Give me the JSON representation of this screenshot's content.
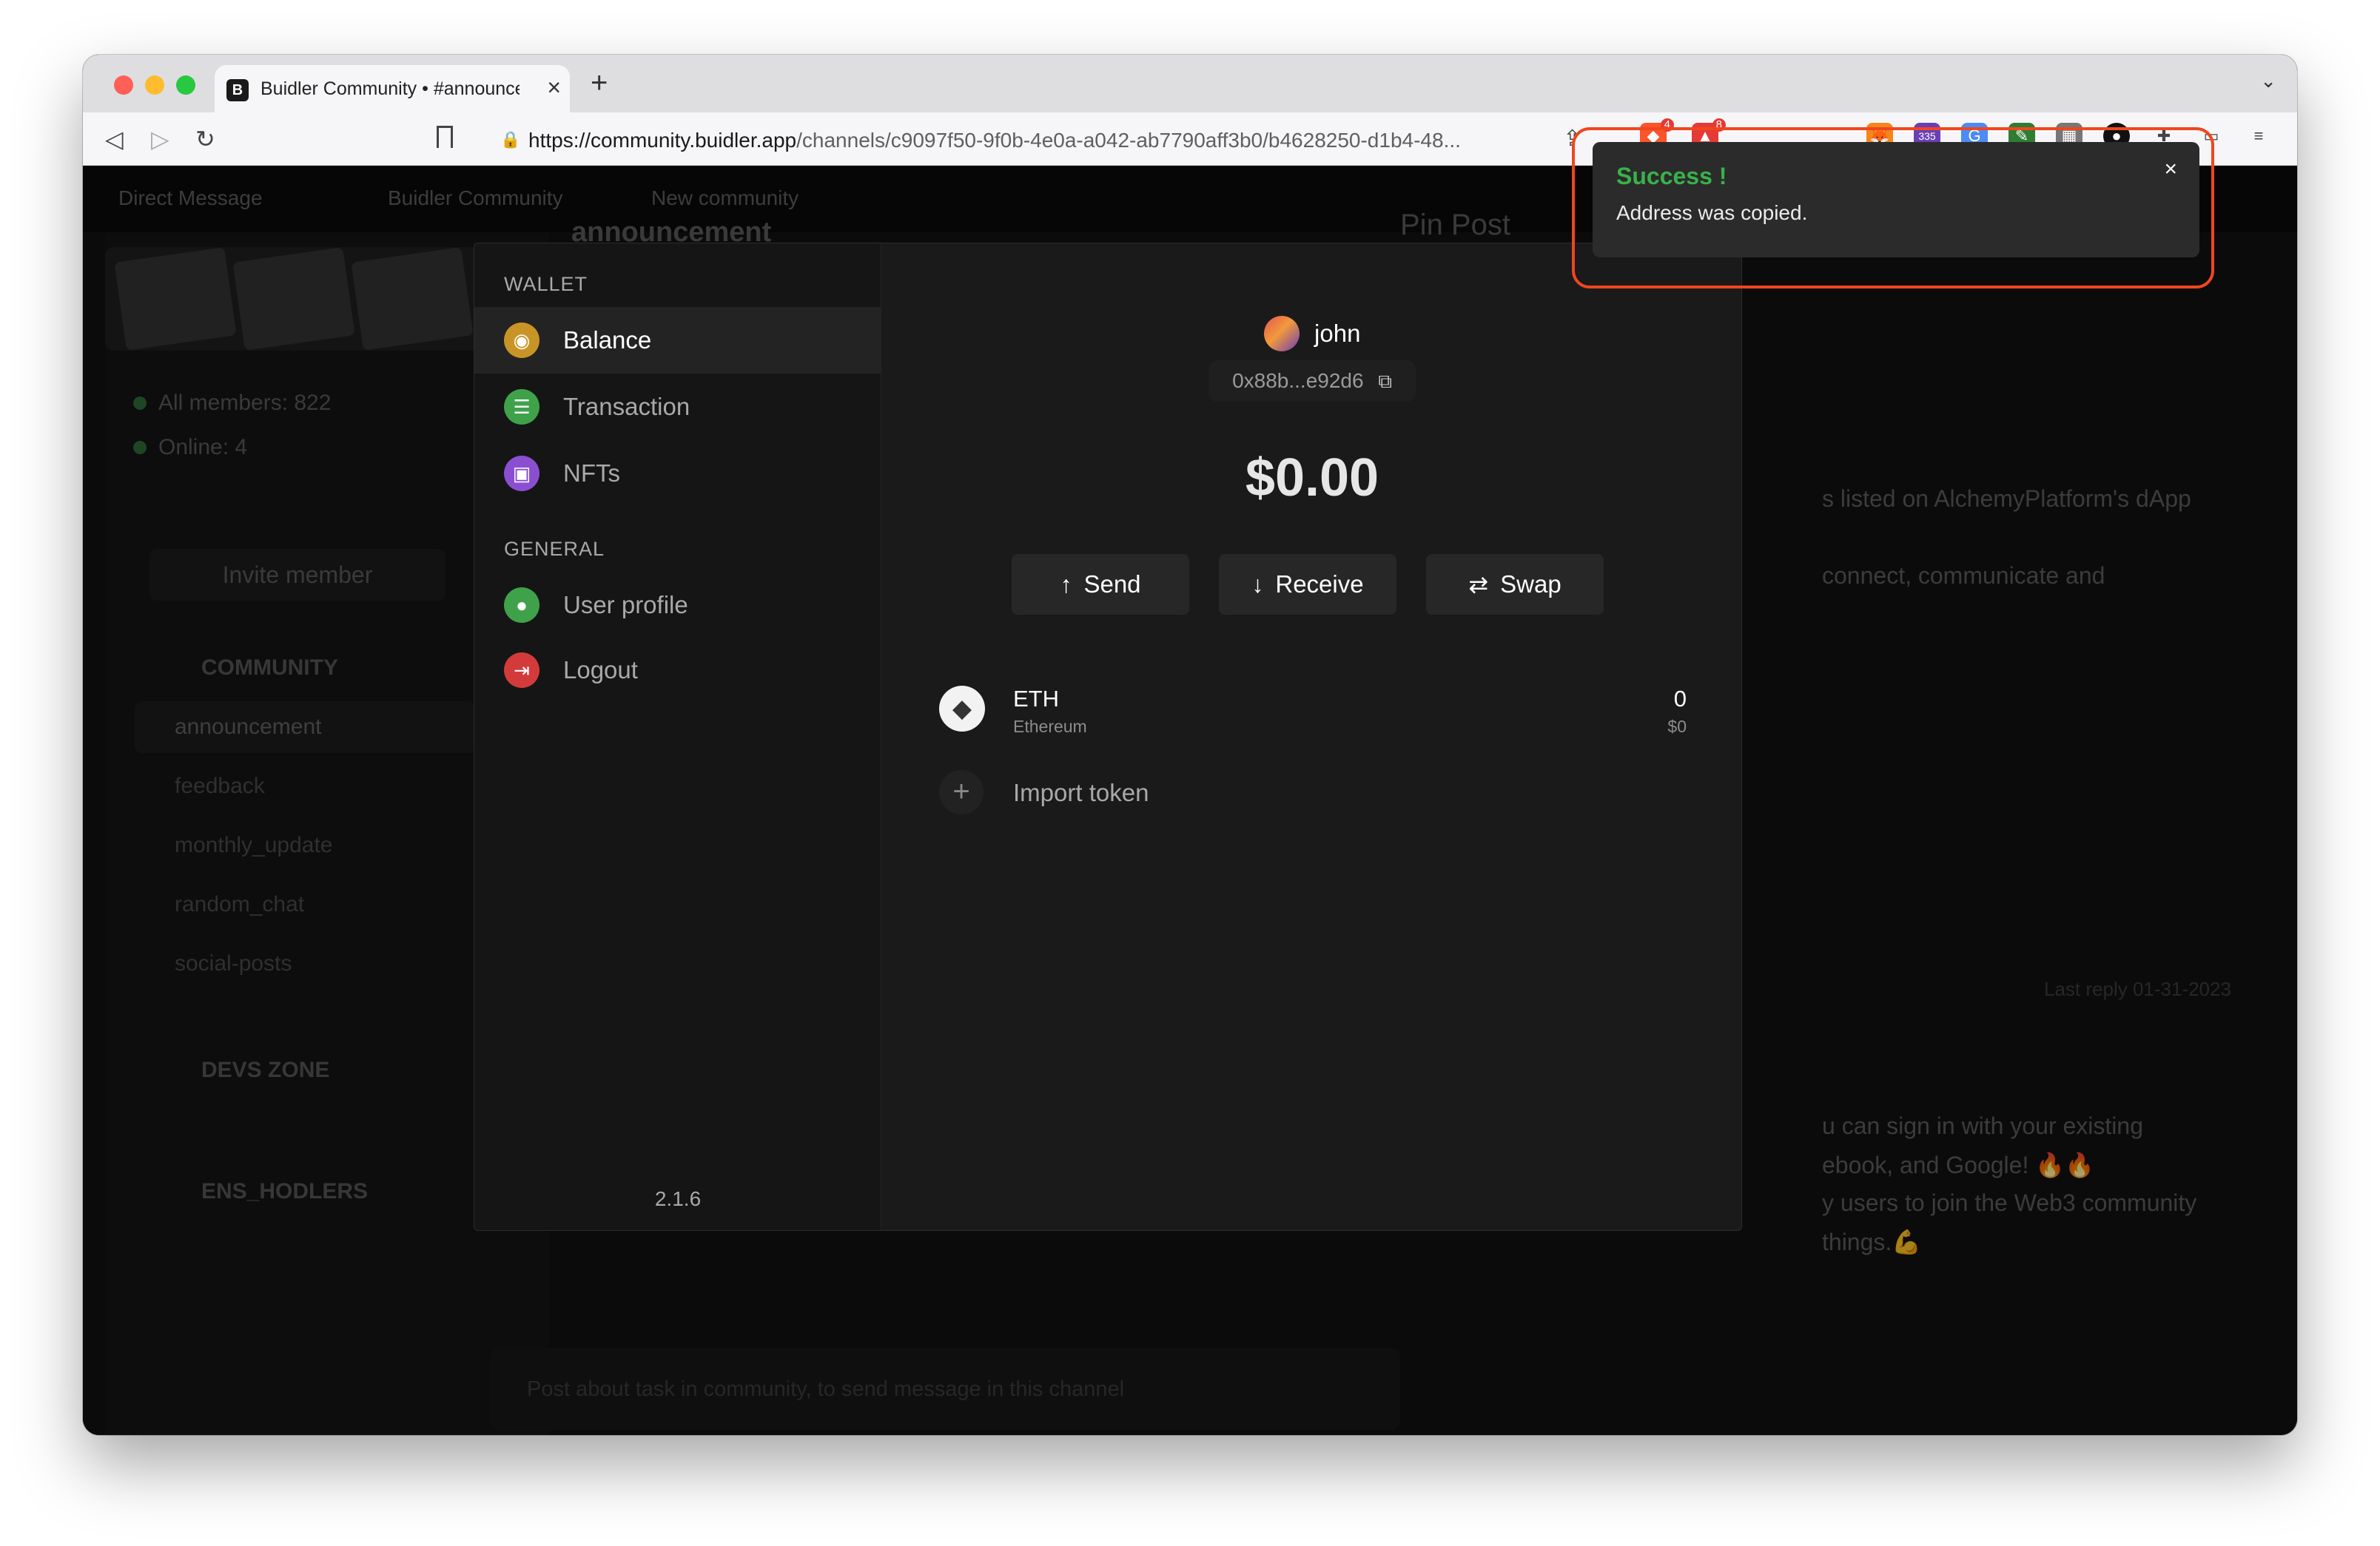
{
  "browser": {
    "tab_title": "Buidler Community • #announcement",
    "new_tab": "+",
    "url_host": "https://community.buidler.app",
    "url_path": "/channels/c9097f50-9f0b-4e0a-a042-ab7790aff3b0/b4628250-d1b4-48...",
    "extensions": [
      {
        "name": "metamask-icon",
        "color": "#f6851b"
      },
      {
        "name": "extension-335-icon",
        "color": "#6a3fb5",
        "badge": "335"
      },
      {
        "name": "translate-icon",
        "color": "#4c8bf5"
      },
      {
        "name": "pen-icon",
        "color": "#2e7d32"
      },
      {
        "name": "puzzle-icon",
        "color": "#777777"
      },
      {
        "name": "circle-icon",
        "color": "#111111"
      },
      {
        "name": "extensions-icon",
        "color": "#444444"
      },
      {
        "name": "wallet-icon",
        "color": "#444444"
      }
    ],
    "brave_badge": "4",
    "rewards_badge": "8"
  },
  "background": {
    "top_strip": [
      "Direct Message",
      "Buidler Community",
      "New community"
    ],
    "members": "All members: 822",
    "online": "Online: 4",
    "invite": "Invite member",
    "community_section": "COMMUNITY",
    "channels": [
      "announcement",
      "feedback",
      "monthly_update",
      "random_chat",
      "social-posts"
    ],
    "devs_zone": "DEVS ZONE",
    "ens_holders": "ENS_HODLERS",
    "channel_title": "announcement",
    "pin_post": "Pin Post",
    "messages": [
      "s listed on AlchemyPlatform's dApp",
      "connect, communicate and",
      "Last reply 01-31-2023",
      "u can sign in with your existing",
      "ebook, and Google! 🔥🔥",
      "y users to join the Web3 community",
      "things.💪"
    ],
    "input_placeholder": "Post about task in community, to send message in this channel"
  },
  "wallet": {
    "wallet_group": "WALLET",
    "general_group": "GENERAL",
    "menu": [
      {
        "label": "Balance",
        "icon": "eye-icon",
        "color": "#c99426",
        "glyph": "👁"
      },
      {
        "label": "Transaction",
        "icon": "list-icon",
        "color": "#3fa24a",
        "glyph": "☰"
      },
      {
        "label": "NFTs",
        "icon": "image-icon",
        "color": "#8a4fd1",
        "glyph": "▣"
      },
      {
        "label": "User profile",
        "icon": "user-icon",
        "color": "#3fa24a",
        "glyph": "●"
      },
      {
        "label": "Logout",
        "icon": "logout-icon",
        "color": "#d33b3b",
        "glyph": "⇥"
      }
    ],
    "version": "2.1.6",
    "username": "john",
    "address": "0x88b...e92d6",
    "balance": "$0.00",
    "actions": {
      "send": "Send",
      "receive": "Receive",
      "swap": "Swap"
    },
    "tokens": [
      {
        "symbol": "ETH",
        "name": "Ethereum",
        "amount": "0",
        "usd": "$0"
      }
    ],
    "import_token": "Import token"
  },
  "toast": {
    "title": "Success !",
    "message": "Address was copied.",
    "close": "×",
    "ring_color": "#f0461e",
    "title_color": "#38b24a"
  }
}
